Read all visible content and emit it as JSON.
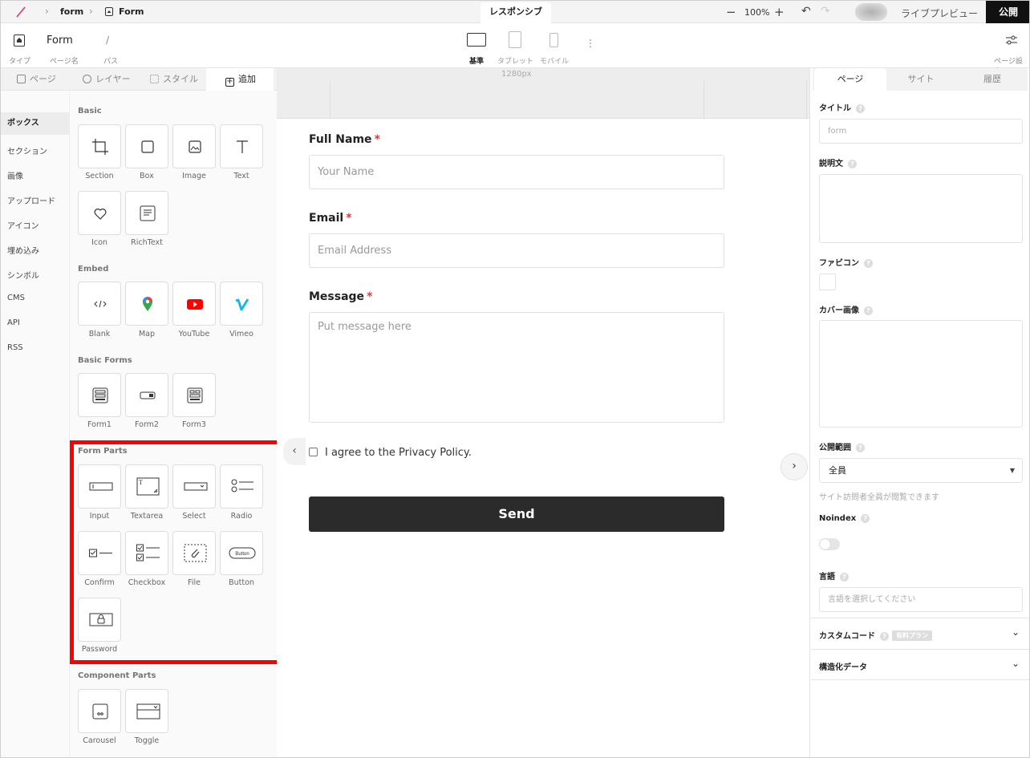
{
  "topbar": {
    "crumb_project": "form",
    "crumb_page": "Form",
    "responsive_tab": "レスポンシブ",
    "zoom": "100%",
    "live_preview": "ライブプレビュー",
    "publish": "公開"
  },
  "header": {
    "page_name": "Form",
    "path": "/",
    "type_label": "タイプ",
    "page_name_label": "ページ名",
    "path_label": "パス",
    "devices": [
      "基準",
      "タブレット",
      "モバイル"
    ],
    "settings_label": "ページ設定"
  },
  "left_tabs": [
    "ページ",
    "レイヤー",
    "スタイル",
    "追加"
  ],
  "categories": [
    "ボックス",
    "セクション",
    "画像",
    "アップロード",
    "アイコン",
    "埋め込み",
    "シンボル",
    "CMS",
    "API",
    "RSS"
  ],
  "palette": {
    "basic_title": "Basic",
    "basic": [
      "Section",
      "Box",
      "Image",
      "Text",
      "Icon",
      "RichText"
    ],
    "embed_title": "Embed",
    "embed": [
      "Blank",
      "Map",
      "YouTube",
      "Vimeo"
    ],
    "basic_forms_title": "Basic Forms",
    "basic_forms": [
      "Form1",
      "Form2",
      "Form3"
    ],
    "form_parts_title": "Form Parts",
    "form_parts": [
      "Input",
      "Textarea",
      "Select",
      "Radio",
      "Confirm",
      "Checkbox",
      "File",
      "Button",
      "Password"
    ],
    "component_parts_title": "Component Parts",
    "component_parts": [
      "Carousel",
      "Toggle"
    ]
  },
  "canvas": {
    "width_label": "1280px",
    "full_name_label": "Full Name",
    "full_name_placeholder": "Your Name",
    "email_label": "Email",
    "email_placeholder": "Email Address",
    "message_label": "Message",
    "message_placeholder": "Put message here",
    "required_mark": "*",
    "privacy_label": "I agree to the Privacy Policy.",
    "send_label": "Send"
  },
  "right_panel": {
    "tabs": [
      "ページ",
      "サイト",
      "履歴"
    ],
    "title_label": "タイトル",
    "title_placeholder": "form",
    "description_label": "説明文",
    "favicon_label": "ファビコン",
    "cover_label": "カバー画像",
    "visibility_label": "公開範囲",
    "visibility_value": "全員",
    "visibility_note": "サイト訪問者全員が閲覧できます",
    "noindex_label": "Noindex",
    "language_label": "言語",
    "language_placeholder": "言語を選択してください",
    "custom_code_label": "カスタムコード",
    "paid_plan_badge": "有料プラン",
    "structured_data_label": "構造化データ",
    "help_mark": "?"
  },
  "colors": {
    "highlight": "#ff0000",
    "send_button": "#2b2b2b",
    "publish_button": "#111111",
    "required": "#e33333"
  }
}
